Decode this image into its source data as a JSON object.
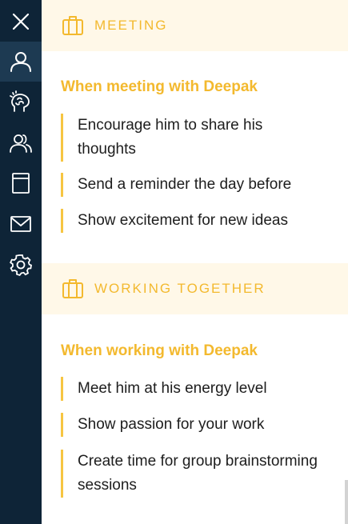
{
  "sidebar": {
    "items": [
      {
        "name": "close-icon",
        "active": false
      },
      {
        "name": "person-icon",
        "active": true
      },
      {
        "name": "brain-icon",
        "active": false
      },
      {
        "name": "people-icon",
        "active": false
      },
      {
        "name": "book-icon",
        "active": false
      },
      {
        "name": "mail-icon",
        "active": false
      },
      {
        "name": "gear-icon",
        "active": false
      }
    ]
  },
  "sections": [
    {
      "icon": "briefcase-icon",
      "title": "MEETING",
      "subheading": "When meeting with Deepak",
      "tips": [
        "Encourage him to share his thoughts",
        "Send a reminder the day before",
        "Show excitement for new ideas"
      ]
    },
    {
      "icon": "briefcase-icon",
      "title": "WORKING TOGETHER",
      "subheading": "When working with Deepak",
      "tips": [
        "Meet him at his energy level",
        "Show passion for your work",
        "Create time for group brainstorming sessions"
      ]
    }
  ],
  "colors": {
    "sidebar_bg": "#0e2437",
    "sidebar_active": "#1d3a52",
    "accent": "#f3b92e",
    "band_bg": "#fff8e8",
    "text": "#1d1d1d"
  }
}
